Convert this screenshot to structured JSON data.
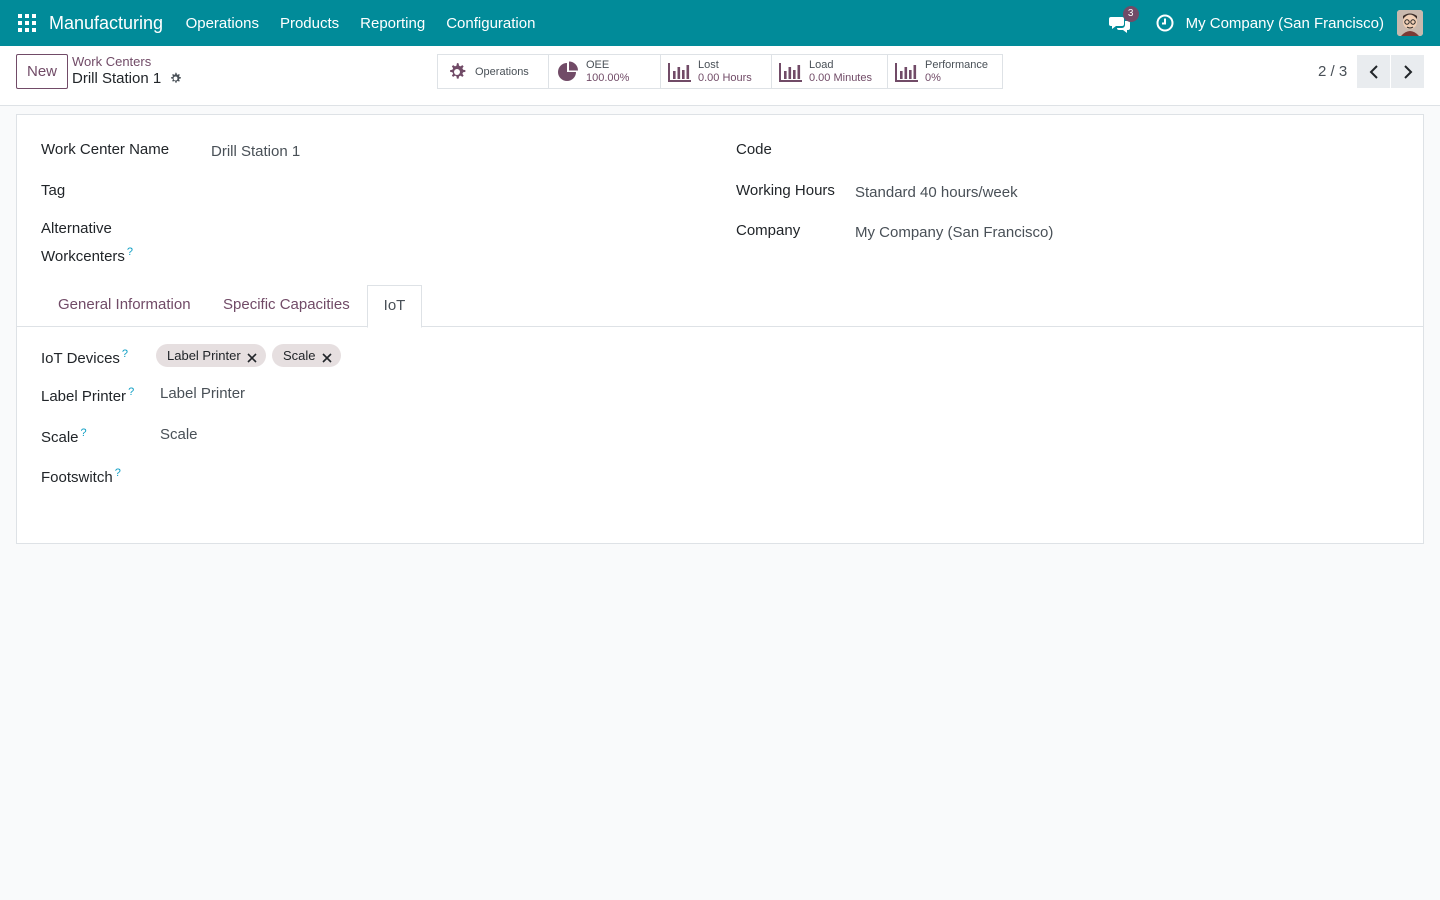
{
  "navbar": {
    "app_name": "Manufacturing",
    "menu": [
      "Operations",
      "Products",
      "Reporting",
      "Configuration"
    ],
    "chat_count": "3",
    "company": "My Company (San Francisco)",
    "icons": {
      "apps": "apps-grid-icon",
      "chat": "chat-icon",
      "clock": "clock-icon"
    },
    "bg_color": "#018b99"
  },
  "control": {
    "new_label": "New",
    "breadcrumb_parent": "Work Centers",
    "breadcrumb_current": "Drill Station 1",
    "pager": "2 / 3",
    "smart_buttons": [
      {
        "icon": "gear-icon",
        "label": "Operations",
        "value": ""
      },
      {
        "icon": "pie-chart-icon",
        "label": "OEE",
        "value": "100.00%"
      },
      {
        "icon": "bar-chart-icon",
        "label": "Lost",
        "value": "0.00 Hours"
      },
      {
        "icon": "bar-chart-icon",
        "label": "Load",
        "value": "0.00 Minutes"
      },
      {
        "icon": "bar-chart-icon",
        "label": "Performance",
        "value": "0%"
      }
    ]
  },
  "form": {
    "work_center_name_label": "Work Center Name",
    "work_center_name": "Drill Station 1",
    "tag_label": "Tag",
    "alt_workcenters_label_1": "Alternative",
    "alt_workcenters_label_2": "Workcenters",
    "code_label": "Code",
    "working_hours_label": "Working Hours",
    "working_hours": "Standard 40 hours/week",
    "company_label": "Company",
    "company": "My Company (San Francisco)",
    "help_mark": "?"
  },
  "tabs": [
    {
      "label": "General Information",
      "active": false
    },
    {
      "label": "Specific Capacities",
      "active": false
    },
    {
      "label": "IoT",
      "active": true
    }
  ],
  "iot": {
    "devices_label": "IoT Devices",
    "devices": [
      "Label Printer",
      "Scale"
    ],
    "label_printer_label": "Label Printer",
    "label_printer": "Label Printer",
    "scale_label": "Scale",
    "scale": "Scale",
    "footswitch_label": "Footswitch"
  },
  "colors": {
    "accent": "#714b67",
    "help": "#0d9ec4"
  }
}
